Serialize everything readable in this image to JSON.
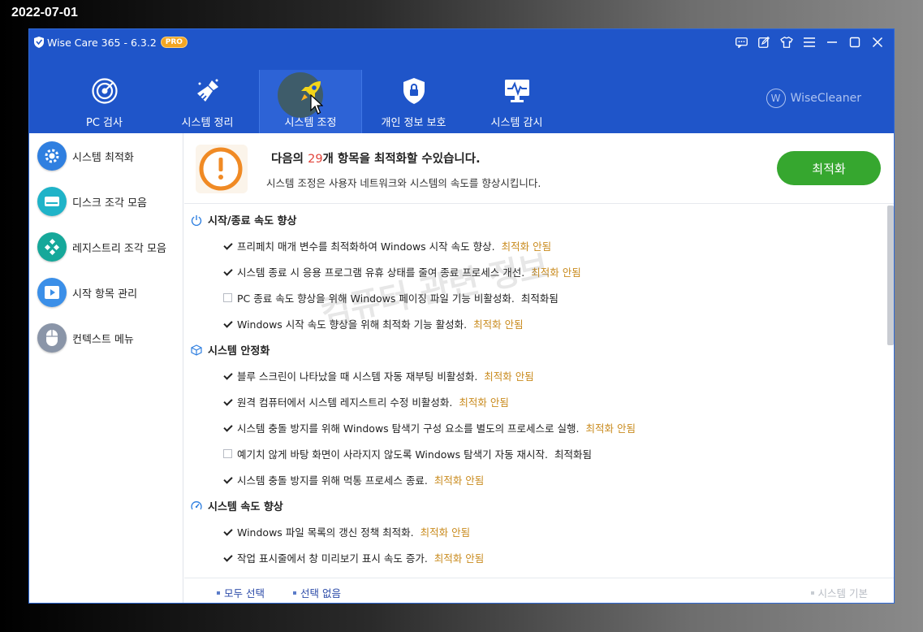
{
  "date_stamp": "2022-07-01",
  "app": {
    "title": "Wise Care 365 - 6.3.2",
    "badge": "PRO"
  },
  "window_controls": [
    "feedback-icon",
    "edit-icon",
    "skin-icon",
    "menu-icon",
    "minimize-icon",
    "maximize-icon",
    "close-icon"
  ],
  "nav": [
    {
      "label": "PC 검사",
      "icon": "radar-icon"
    },
    {
      "label": "시스템 정리",
      "icon": "broom-icon"
    },
    {
      "label": "시스템 조정",
      "icon": "rocket-icon",
      "active": true
    },
    {
      "label": "개인 정보 보호",
      "icon": "privacy-shield-icon"
    },
    {
      "label": "시스템 감시",
      "icon": "monitor-icon"
    }
  ],
  "brand": {
    "mark": "W",
    "text": "WiseCleaner"
  },
  "sidebar": [
    {
      "label": "시스템 최적화",
      "icon": "gear-icon",
      "color": "#2f7fe0"
    },
    {
      "label": "디스크 조각 모음",
      "icon": "disk-icon",
      "color": "#1fb3c8"
    },
    {
      "label": "레지스트리 조각 모음",
      "icon": "registry-icon",
      "color": "#16a89a"
    },
    {
      "label": "시작 항목 관리",
      "icon": "play-icon",
      "color": "#3b8fe8"
    },
    {
      "label": "컨텍스트 메뉴",
      "icon": "mouse-icon",
      "color": "#8a95a8"
    }
  ],
  "summary": {
    "headline_prefix": "다음의",
    "count": "29",
    "headline_suffix": "개 항목을 최적화할 수있습니다.",
    "sub": "시스템 조정은 사용자 네트워크와 시스템의 속도를 향상시킵니다.",
    "optimize_label": "최적화"
  },
  "sections": [
    {
      "title": "시작/종료 속도 향상",
      "icon": "power-icon",
      "items": [
        {
          "text": "프리페치 매개 변수를 최적화하여 Windows 시작 속도 향상.",
          "status": "최적화 안됨",
          "checked": true
        },
        {
          "text": "시스템 종료 시 응용 프로그램 유휴 상태를 줄여 종료 프로세스 개선.",
          "status": "최적화 안됨",
          "checked": true
        },
        {
          "text": "PC 종료 속도 향상을 위해 Windows 페이징 파일 기능 비활성화.",
          "status": "최적화됨",
          "checked": false
        },
        {
          "text": "Windows 시작 속도 향상을 위해 최적화 기능 활성화.",
          "status": "최적화 안됨",
          "checked": true
        }
      ]
    },
    {
      "title": "시스템 안정화",
      "icon": "cube-icon",
      "items": [
        {
          "text": "블루 스크린이 나타났을 때 시스템 자동 재부팅 비활성화.",
          "status": "최적화 안됨",
          "checked": true
        },
        {
          "text": "원격 컴퓨터에서 시스템 레지스트리 수정 비활성화.",
          "status": "최적화 안됨",
          "checked": true
        },
        {
          "text": "시스템 충돌 방지를 위해 Windows 탐색기 구성 요소를 별도의 프로세스로 실행.",
          "status": "최적화 안됨",
          "checked": true
        },
        {
          "text": "예기치 않게 바탕 화면이 사라지지 않도록 Windows 탐색기 자동 재시작.",
          "status": "최적화됨",
          "checked": false
        },
        {
          "text": "시스템 충돌 방지를 위해 먹통 프로세스 종료.",
          "status": "최적화 안됨",
          "checked": true
        }
      ]
    },
    {
      "title": "시스템 속도 향상",
      "icon": "speedometer-icon",
      "items": [
        {
          "text": "Windows 파일 목록의 갱신 정책 최적화.",
          "status": "최적화 안됨",
          "checked": true
        },
        {
          "text": "작업 표시줄에서 창 미리보기 표시 속도 증가.",
          "status": "최적화 안됨",
          "checked": true
        }
      ]
    }
  ],
  "watermark": "컴퓨터 관련 정보",
  "footer": {
    "select_all": "모두 선택",
    "select_none": "선택 없음",
    "restore": "시스템 기본"
  }
}
